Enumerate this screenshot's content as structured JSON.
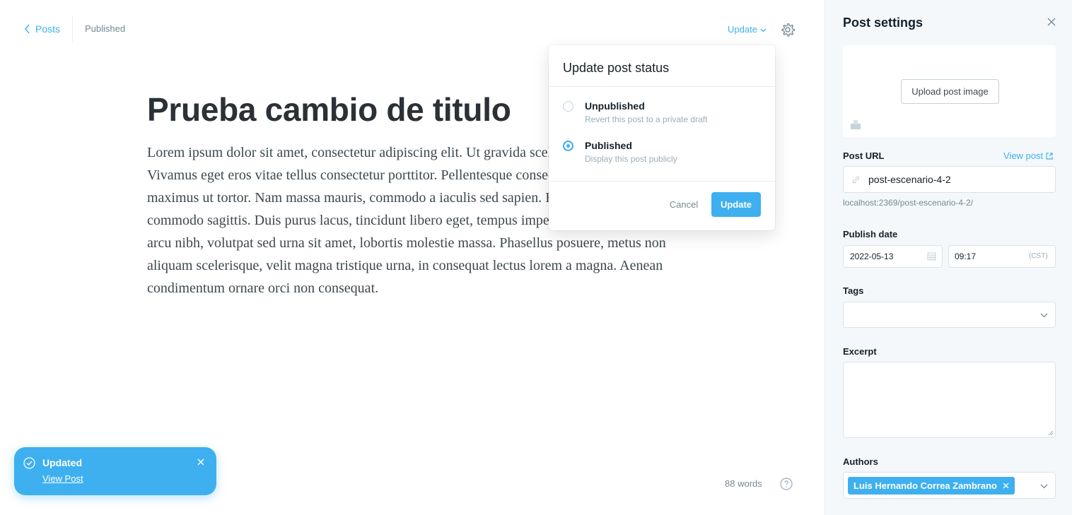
{
  "topbar": {
    "back_label": "Posts",
    "status": "Published",
    "update_label": "Update"
  },
  "editor": {
    "title": "Prueba cambio de titulo",
    "body": "Lorem ipsum dolor sit amet, consectetur adipiscing elit. Ut gravida scelerisque pellentesque. Vivamus eget eros vitae tellus consectetur porttitor. Pellentesque consequat quis feugiat nec, maximus ut tortor. Nam massa mauris, commodo a iaculis sed sapien. Etiam ullamcorper commodo sagittis. Duis purus lacus, tincidunt libero eget, tempus imperdiet nisl. Quisque arcu nibh, volutpat sed urna sit amet, lobortis molestie massa. Phasellus posuere, metus non aliquam scelerisque, velit magna tristique urna, in consequat lectus lorem a magna. Aenean condimentum ornare orci non consequat.",
    "word_count": "88 words"
  },
  "popover": {
    "title": "Update post status",
    "options": [
      {
        "label": "Unpublished",
        "description": "Revert this post to a private draft",
        "checked": false
      },
      {
        "label": "Published",
        "description": "Display this post publicly",
        "checked": true
      }
    ],
    "cancel_label": "Cancel",
    "update_label": "Update"
  },
  "toast": {
    "title": "Updated",
    "link_label": "View Post"
  },
  "settings": {
    "title": "Post settings",
    "upload_label": "Upload post image",
    "url_label": "Post URL",
    "view_post_label": "View post",
    "slug": "post-escenario-4-2",
    "url_hint": "localhost:2369/post-escenario-4-2/",
    "publish_date_label": "Publish date",
    "date": "2022-05-13",
    "time": "09:17",
    "timezone": "(CST)",
    "tags_label": "Tags",
    "excerpt_label": "Excerpt",
    "authors_label": "Authors",
    "author": "Luis Hernando Correa Zambrano"
  },
  "colors": {
    "accent": "#3eb0ef",
    "text": "#15212a",
    "muted": "#738a94",
    "panel_bg": "#f4f8fb"
  },
  "icons": [
    "chevron-left-icon",
    "chevron-down-icon",
    "gear-icon",
    "check-circle-icon",
    "close-icon",
    "help-icon",
    "image-icon",
    "external-link-icon",
    "link-icon",
    "calendar-icon"
  ]
}
